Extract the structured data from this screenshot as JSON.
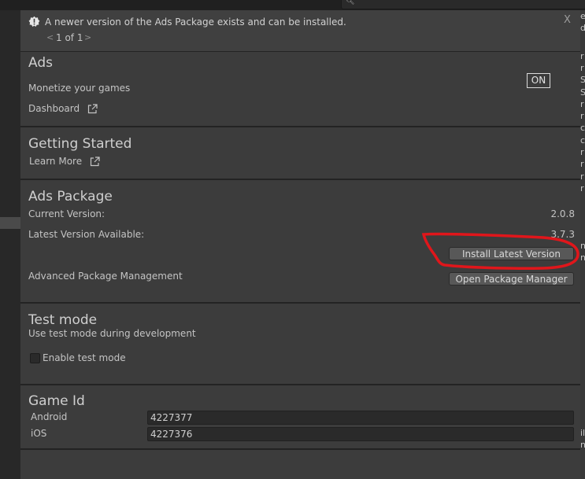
{
  "notice": {
    "message": "A newer version of the Ads Package exists and can be installed.",
    "close": "X",
    "pager_prev": "<",
    "pager_text": "1 of 1",
    "pager_next": ">"
  },
  "ads": {
    "title": "Ads",
    "subtitle": "Monetize your games",
    "toggle": "ON",
    "dashboard_link": "Dashboard"
  },
  "getting_started": {
    "title": "Getting Started",
    "learn_more": "Learn More"
  },
  "ads_package": {
    "title": "Ads Package",
    "current_label": "Current Version:",
    "current_value": "2.0.8",
    "latest_label": "Latest Version Available:",
    "latest_value": "3.7.3",
    "install_button": "Install Latest Version",
    "advanced_label": "Advanced Package Management",
    "open_pm_button": "Open Package Manager"
  },
  "test_mode": {
    "title": "Test mode",
    "description": "Use test mode during development",
    "checkbox_label": "Enable test mode",
    "checked": false
  },
  "game_id": {
    "title": "Game Id",
    "rows": [
      {
        "platform": "Android",
        "value": "4227377"
      },
      {
        "platform": "iOS",
        "value": "4227376"
      }
    ]
  },
  "colors": {
    "panel": "#3c3c3c",
    "annotation_red": "#e0161b"
  }
}
